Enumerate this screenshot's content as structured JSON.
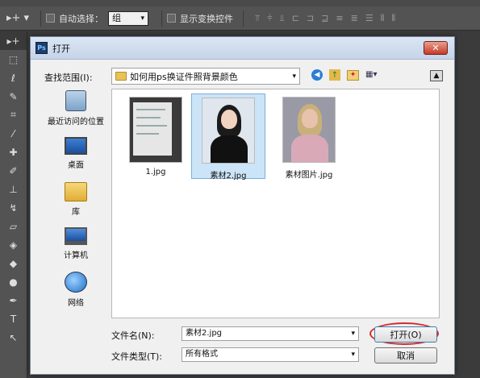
{
  "ps_options": {
    "auto_select_label": "自动选择：",
    "auto_select_value": "组",
    "show_transform_label": "显示变换控件"
  },
  "dialog": {
    "logo": "Ps",
    "title": "打开",
    "close_label": "✕",
    "look_in_label": "查找范围(I):",
    "look_in_value": "如何用ps换证件照背景颜色"
  },
  "places": [
    {
      "label": "最近访问的位置",
      "icon": "recent-places-icon"
    },
    {
      "label": "桌面",
      "icon": "desktop-icon"
    },
    {
      "label": "库",
      "icon": "library-icon"
    },
    {
      "label": "计算机",
      "icon": "computer-icon"
    },
    {
      "label": "网络",
      "icon": "network-icon"
    }
  ],
  "files": [
    {
      "name": "1.jpg",
      "selected": false
    },
    {
      "name": "素材2.jpg",
      "selected": true
    },
    {
      "name": "素材图片.jpg",
      "selected": false
    }
  ],
  "bottom": {
    "filename_label": "文件名(N):",
    "filename_value": "素材2.jpg",
    "filetype_label": "文件类型(T):",
    "filetype_value": "所有格式",
    "open_button": "打开(O)",
    "cancel_button": "取消"
  },
  "colors": {
    "selection": "#cce4f7",
    "highlight_circle": "#d52b2b"
  }
}
